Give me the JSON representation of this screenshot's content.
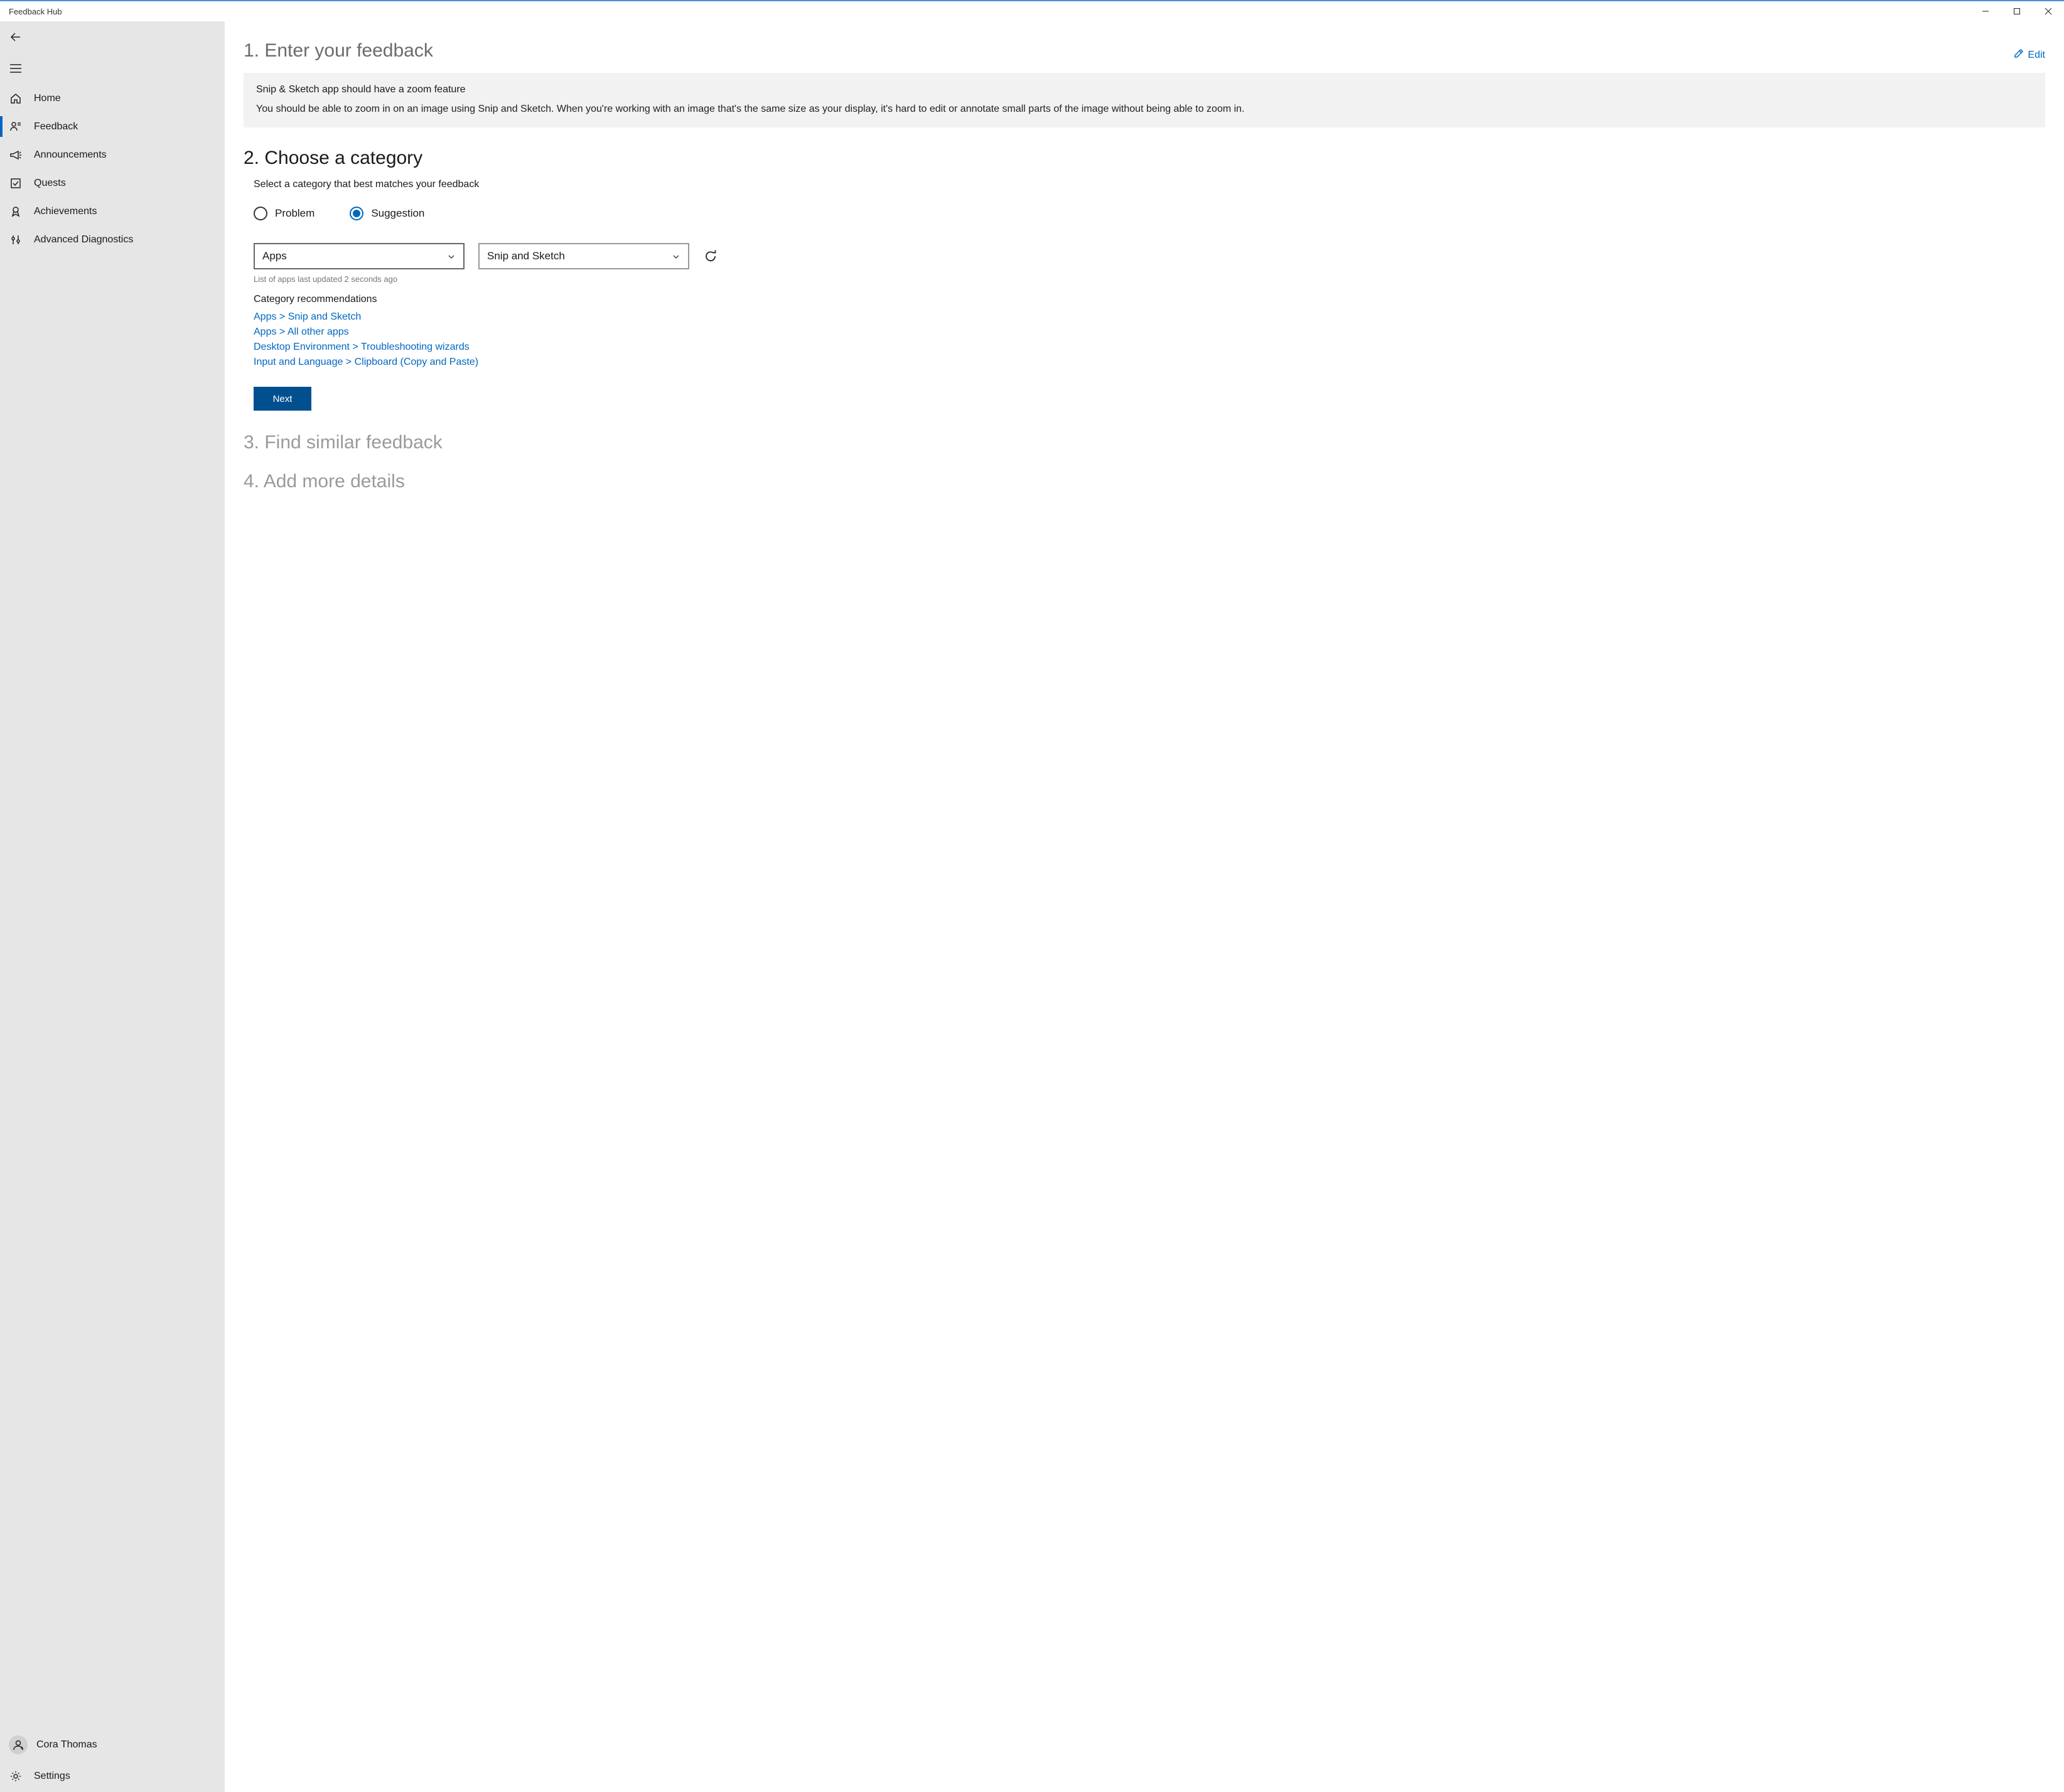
{
  "titlebar": {
    "app_title": "Feedback Hub"
  },
  "sidebar": {
    "items": [
      {
        "label": "Home"
      },
      {
        "label": "Feedback"
      },
      {
        "label": "Announcements"
      },
      {
        "label": "Quests"
      },
      {
        "label": "Achievements"
      },
      {
        "label": "Advanced Diagnostics"
      }
    ],
    "user_name": "Cora Thomas",
    "settings_label": "Settings"
  },
  "step1": {
    "title": "1. Enter your feedback",
    "edit_label": "Edit",
    "feedback_title": "Snip & Sketch app should have a zoom feature",
    "feedback_body": "You should be able to zoom in on an image using Snip and Sketch. When you're working with an image that's the same size as your display, it's hard to edit or annotate small parts of the image without being able to zoom in."
  },
  "step2": {
    "title": "2. Choose a category",
    "subtitle": "Select a category that best matches your feedback",
    "radio_problem": "Problem",
    "radio_suggestion": "Suggestion",
    "dropdown_category": "Apps",
    "dropdown_subcategory": "Snip and Sketch",
    "update_note": "List of apps last updated 2 seconds ago",
    "recs_title": "Category recommendations",
    "recs": [
      "Apps > Snip and Sketch",
      "Apps > All other apps",
      "Desktop Environment > Troubleshooting wizards",
      "Input and Language > Clipboard (Copy and Paste)"
    ],
    "next_label": "Next"
  },
  "step3": {
    "title": "3. Find similar feedback"
  },
  "step4": {
    "title": "4. Add more details"
  }
}
